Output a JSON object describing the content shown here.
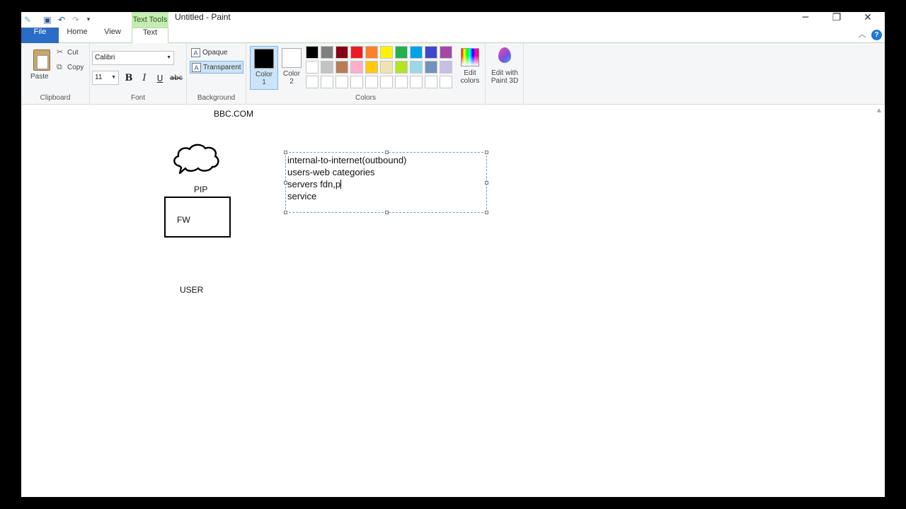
{
  "window": {
    "title": "Untitled - Paint",
    "context_tab": "Text Tools",
    "minimize": "─",
    "restore": "❐",
    "close": "✕"
  },
  "tabs": [
    {
      "label": "File"
    },
    {
      "label": "Home"
    },
    {
      "label": "View"
    },
    {
      "label": "Text"
    }
  ],
  "help": "?",
  "ribbon": {
    "clipboard": {
      "group_label": "Clipboard",
      "paste": "Paste",
      "cut": "Cut",
      "copy": "Copy"
    },
    "font": {
      "group_label": "Font",
      "family": "Calibri",
      "size": "11",
      "bold": "B",
      "italic": "I",
      "underline": "U",
      "strikethrough": "abc"
    },
    "background": {
      "group_label": "Background",
      "opaque": "Opaque",
      "transparent": "Transparent",
      "selected": "transparent"
    },
    "colors": {
      "group_label": "Colors",
      "color1_label": "Color",
      "color1_num": "1",
      "color2_label": "Color",
      "color2_num": "2",
      "color1": "#000000",
      "color2": "#ffffff",
      "palette_row1": [
        "#000000",
        "#7f7f7f",
        "#880015",
        "#ed1c24",
        "#ff7f27",
        "#fff200",
        "#22b14c",
        "#00a2e8",
        "#3f48cc",
        "#a349a4"
      ],
      "palette_row2": [
        "#ffffff",
        "#c3c3c3",
        "#b97a57",
        "#ffaec9",
        "#ffc90e",
        "#efe4b0",
        "#b5e61d",
        "#99d9ea",
        "#7092be",
        "#c8bfe7"
      ],
      "palette_row3": [
        "#ffffff",
        "#ffffff",
        "#ffffff",
        "#ffffff",
        "#ffffff",
        "#ffffff",
        "#ffffff",
        "#ffffff",
        "#ffffff",
        "#ffffff"
      ],
      "edit_colors_1": "Edit",
      "edit_colors_2": "colors"
    },
    "paint3d": {
      "line1": "Edit with",
      "line2": "Paint 3D"
    }
  },
  "canvas": {
    "label_top": "BBC.COM",
    "label_pip": "PIP",
    "label_fw": "FW",
    "label_user": "USER",
    "textbox_lines": [
      "internal-to-internet(outbound)",
      "users-web categories",
      "servers fdn,p",
      "service"
    ]
  }
}
